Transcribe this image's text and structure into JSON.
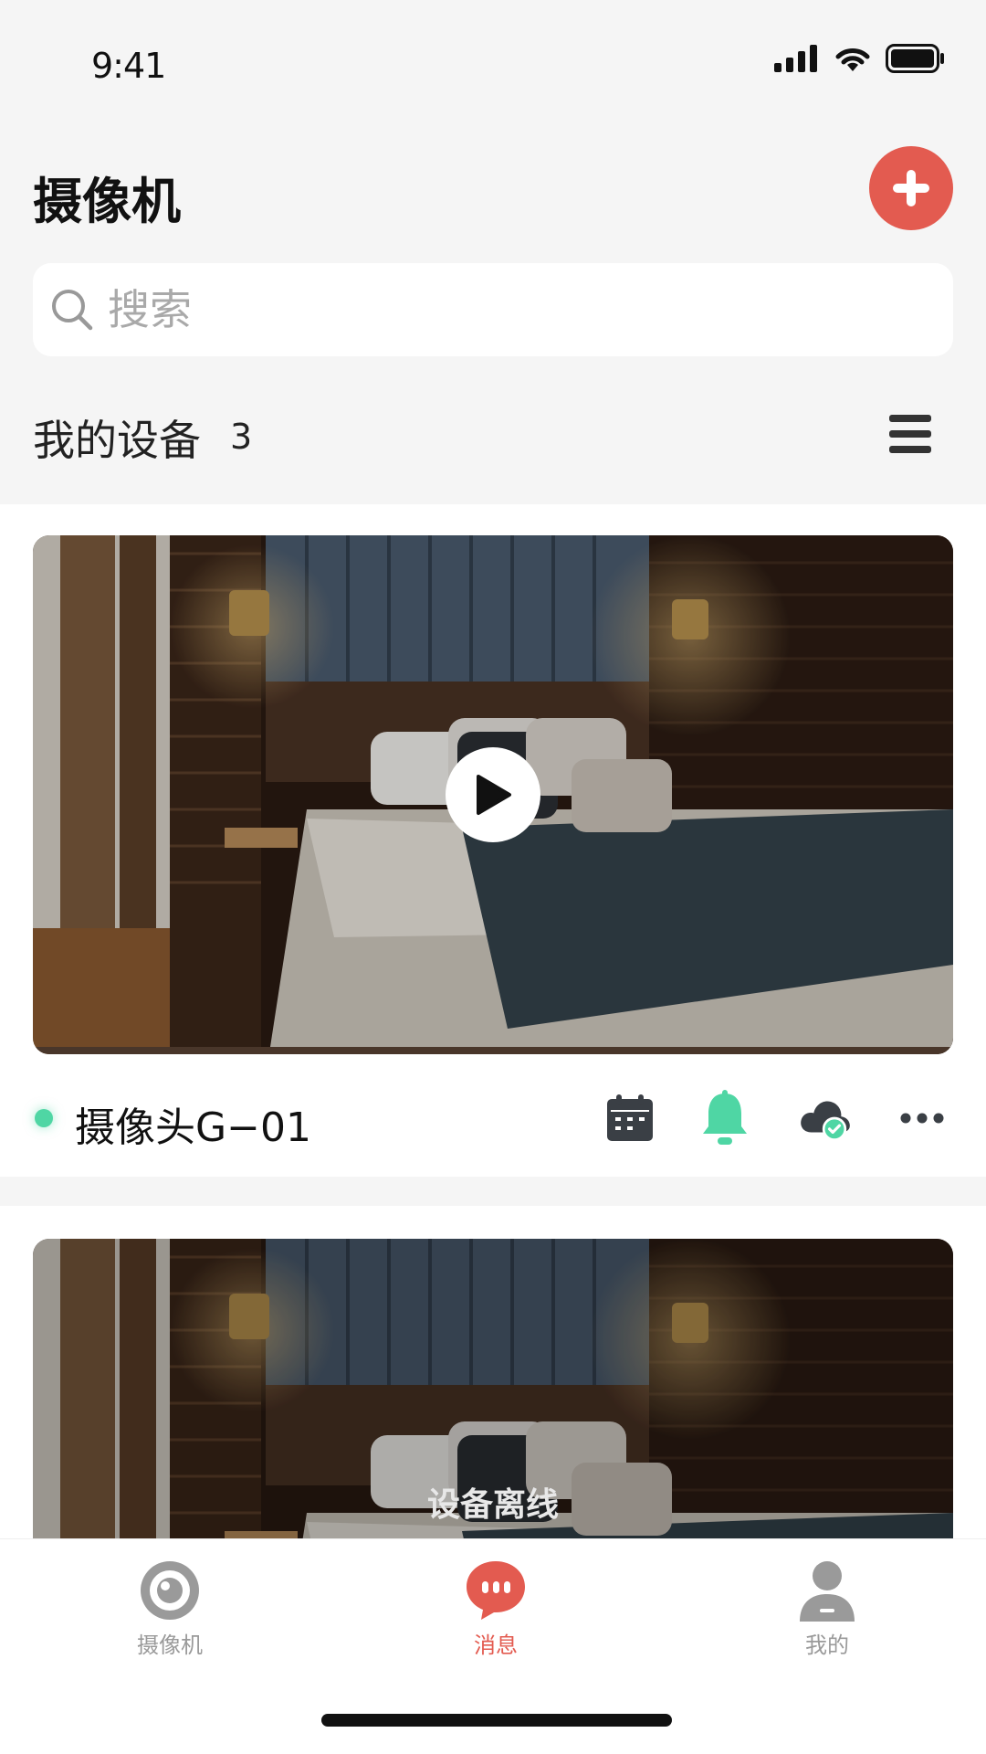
{
  "status_bar": {
    "time": "9:41"
  },
  "header": {
    "title": "摄像机",
    "add_icon": "plus-icon"
  },
  "search": {
    "placeholder": "搜索",
    "icon": "search-icon"
  },
  "devices_section": {
    "title": "我的设备",
    "count": "3",
    "toggle_icon": "list-icon"
  },
  "devices": [
    {
      "name": "摄像头G−01",
      "status": "online",
      "preview_icon": "play-icon",
      "actions": [
        "calendar-icon",
        "bell-icon",
        "cloud-check-icon",
        "more-icon"
      ]
    },
    {
      "overlay_text": "设备离线"
    }
  ],
  "tab_bar": {
    "tabs": [
      {
        "label": "摄像机",
        "icon": "camera-icon",
        "active": false
      },
      {
        "label": "消息",
        "icon": "message-icon",
        "active": true
      },
      {
        "label": "我的",
        "icon": "profile-icon",
        "active": false
      }
    ]
  },
  "colors": {
    "accent": "#e35b50",
    "online": "#4fd6a4",
    "background": "#f5f5f5",
    "inactive_tab": "#9a9a9a"
  }
}
